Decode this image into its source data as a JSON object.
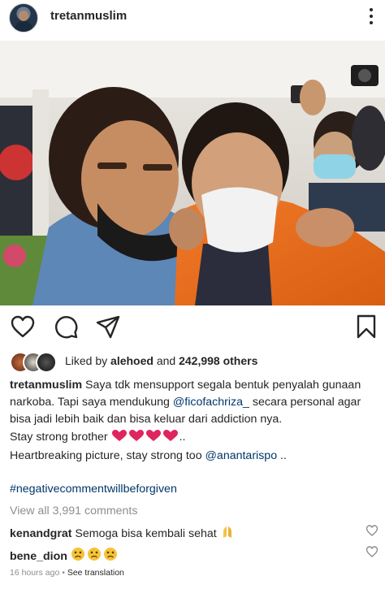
{
  "post": {
    "username": "tretanmuslim",
    "more_icon": "more-vertical-icon"
  },
  "actions": {
    "like_icon": "heart-outline-icon",
    "comment_icon": "comment-bubble-icon",
    "share_icon": "paper-plane-icon",
    "save_icon": "bookmark-icon"
  },
  "likes": {
    "prefix": "Liked by ",
    "user": "alehoed",
    "middle": " and ",
    "count": "242,998 others"
  },
  "caption": {
    "username": "tretanmuslim",
    "line1": " Saya tdk mensupport segala bentuk penyalah gunaan narkoba. Tapi saya mendukung ",
    "mention1": "@ficofachriza_",
    "line2": " secara personal agar bisa jadi lebih baik dan bisa keluar dari addiction nya.",
    "line3": "Stay strong brother ",
    "line3_suffix": "..",
    "line4": "Heartbreaking picture, stay strong too ",
    "mention2": "@anantarispo",
    "line4_suffix": " ..",
    "hashtag": "#negativecommentwillbeforgiven"
  },
  "view_all": "View all 3,991 comments",
  "comments": [
    {
      "username": "kenandgrat",
      "text": " Semoga bisa kembali sehat "
    },
    {
      "username": "bene_dion",
      "text": " "
    }
  ],
  "timestamp": "16 hours ago",
  "separator": " • ",
  "see_translation": "See translation"
}
